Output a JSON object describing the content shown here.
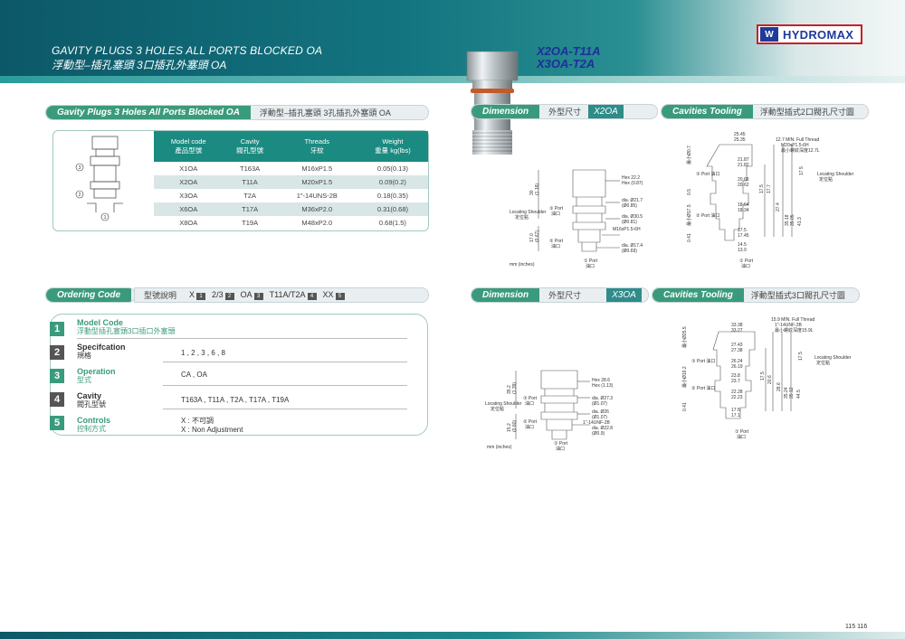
{
  "header": {
    "title_en": "GAVITY PLUGS 3 HOLES ALL PORTS BLOCKED OA",
    "title_zh": "浮動型–插孔塞頭  3口插孔外塞頭  OA",
    "models": [
      "X2OA-T11A",
      "X3OA-T2A"
    ],
    "brand": "HYDROMAX",
    "brand_mark": "W"
  },
  "sections": {
    "gavity_bar_tab": "Gavity Plugs 3 Holes All Ports Blocked OA",
    "gavity_bar_sub": "浮動型–插孔塞頭  3孔插孔外塞頭  OA",
    "dim1_tab": "Dimension",
    "dim1_sub": "外型尺寸",
    "dim1_code": "X2OA",
    "cav1_tab": "Cavities Tooling",
    "cav1_sub": "浮動型插式2口閥孔尺寸圖",
    "dim2_tab": "Dimension",
    "dim2_sub": "外型尺寸",
    "dim2_code": "X3OA",
    "cav2_tab": "Cavities Tooling",
    "cav2_sub": "浮動型插式3口閥孔尺寸圖",
    "order_tab": "Ordering Code",
    "order_sub": "型號說明"
  },
  "spec_table": {
    "headers": [
      {
        "en": "Model code",
        "zh": "產品型號"
      },
      {
        "en": "Cavity",
        "zh": "閥孔型號"
      },
      {
        "en": "Threads",
        "zh": "牙紋"
      },
      {
        "en": "Weight",
        "zh": "重量  kg(lbs)"
      }
    ],
    "rows": [
      [
        "X1OA",
        "T163A",
        "M16xP1.5",
        "0.05(0.13)"
      ],
      [
        "X2OA",
        "T11A",
        "M20xP1.5",
        "0.09(0.2)"
      ],
      [
        "X3OA",
        "T2A",
        "1\"-14UNS-2B",
        "0.18(0.35)"
      ],
      [
        "X6OA",
        "T17A",
        "M36xP2.0",
        "0.31(0.68)"
      ],
      [
        "X8OA",
        "T19A",
        "M48xP2.0",
        "0.68(1.5)"
      ]
    ]
  },
  "sketch_labels": [
    "3",
    "2",
    "1"
  ],
  "order_code": {
    "parts": [
      "X",
      "1",
      "2",
      "3",
      "OA",
      "2",
      "T11A",
      "T2A",
      "4",
      "XX",
      "5"
    ]
  },
  "ordering": [
    {
      "n": "1",
      "en": "Model Code",
      "zh": "浮動型插孔塞頭3口插口外塞頭",
      "value": "",
      "color": "#3a9b7c"
    },
    {
      "n": "2",
      "en": "Specifcation",
      "zh": "規格",
      "value": "1 , 2 , 3 , 6 , 8",
      "color": "#555555"
    },
    {
      "n": "3",
      "en": "Operation",
      "zh": "型式",
      "value": "CA , OA",
      "color": "#3a9b7c"
    },
    {
      "n": "4",
      "en": "Cavity",
      "zh": "閥孔型號",
      "value": "T163A , T11A , T2A , T17A , T19A",
      "color": "#555555"
    },
    {
      "n": "5",
      "en": "Controls",
      "zh": "控制方式",
      "value": "X : 不可調",
      "value2": "X : Non Adjustment",
      "color": "#3a9b7c"
    }
  ],
  "x2oa_dims": {
    "hex": "Hex  22.2",
    "hex_in": "Hex  (0.87)",
    "d1": "dia. Ø21.7",
    "d1_in": "(Ø0.85)",
    "d2": "dia. Ø30.5",
    "d2_in": "(Ø0.81)",
    "thread": "M16xP1.5-6H",
    "d3": "dia. Ø17.4",
    "d3_in": "(Ø0.69)",
    "h1": "30",
    "h1_in": "(1.18)",
    "h2": "17.0",
    "h2_in": "(0.67)",
    "shoulder": "Locating Shoulder",
    "shoulder_zh": "定位點",
    "port3": "③ Port",
    "port3_zh": "油口",
    "port2": "② Port",
    "port2_zh": "油口",
    "port1": "① Port",
    "port1_zh": "油口",
    "units": "mm (inches)"
  },
  "x2oa_cav": {
    "top1": "25.45",
    "top2": "25.35",
    "thread_note1": "12.7 MIN. Full Thread",
    "thread_note2": "M20xP1.5-6H",
    "thread_note3": "最小螺紋深度12.7L",
    "a1": "21.87",
    "a2": "21.82",
    "b1": "20.68",
    "b2": "20.62",
    "c1": "18.64",
    "c2": "18.34",
    "e1": "17.5",
    "e2": "17.45",
    "f1": "14.5",
    "f2": "13.9",
    "h1": "17.5",
    "h2": "17.7",
    "h3": "27.4",
    "h4": "35.18",
    "h5": "35.05",
    "h6": "41.3",
    "l1": "最小Ø0.7",
    "l2": "0.5",
    "l3": "最小Ø17.5",
    "l4": "0.41",
    "shoulder": "Locating Shoulder",
    "shoulder_zh": "定位點",
    "port3": "③ Port 油口",
    "port2": "② Port 油口",
    "port1": "① Port",
    "port1_zh": "油口"
  },
  "x3oa_dims": {
    "hex": "Hex  28.6",
    "hex_in": "Hex  (1.13)",
    "d1": "dia. Ø27.3",
    "d1_in": "(Ø1.07)",
    "d2": "dia. Ø26",
    "d2_in": "(Ø1.07)",
    "thread": "1\"-14UNF-2B",
    "d3": "dia. Ø22.8",
    "d3_in": "(Ø0.9)",
    "h1": "35.2",
    "h1_in": "(1.39)",
    "h2": "15.2",
    "h2_in": "(0.60)",
    "shoulder": "Locating Shoulder",
    "shoulder_zh": "定位點",
    "port3": "③ Port",
    "port3_zh": "油口",
    "port2": "② Port",
    "port2_zh": "油口",
    "port1": "① Port",
    "port1_zh": "油口",
    "units": "mm (inches)"
  },
  "x3oa_cav": {
    "thread_note1": "15.9 MIN. Full Thread",
    "thread_note2": "1\"-14UNF-2B",
    "thread_note3": "最小螺紋深度15.9L",
    "top1": "33.38",
    "top2": "33.27",
    "a1": "27.43",
    "a2": "27.38",
    "b1": "26.24",
    "b2": "26.19",
    "c1": "23.8",
    "c2": "23.7",
    "d1": "22.28",
    "d2": "22.23",
    "e1": "17.5",
    "e2": "17.1",
    "h1": "17.5",
    "h2": "20.6",
    "h3": "28.6",
    "h4": "35.24",
    "h5": "35.12",
    "h6": "44.5",
    "l1": "最小Ø25.5",
    "l2": "最小Ø19.2",
    "l3": "0.41",
    "shoulder": "Locating Shoulder",
    "shoulder_zh": "定位點",
    "port3": "③ Port 油口",
    "port2": "② Port 油口",
    "port1": "① Port",
    "port1_zh": "油口"
  },
  "page_numbers": "115  116",
  "colors": {
    "teal": "#1b8a80",
    "green": "#3a9b7c",
    "brand_red": "#c8202a",
    "brand_blue": "#1f3b9a"
  }
}
